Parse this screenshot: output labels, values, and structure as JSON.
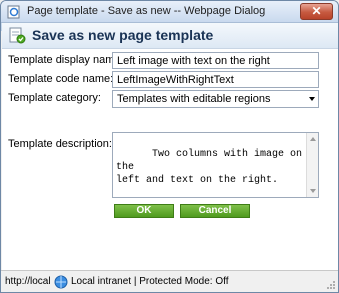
{
  "window": {
    "title": "Page template - Save as new -- Webpage Dialog",
    "close_label": "✕"
  },
  "header": {
    "title": "Save as new page template"
  },
  "form": {
    "display_name_label": "Template display name:",
    "display_name_value": "Left image with text on the right",
    "code_name_label": "Template code name:",
    "code_name_value": "LeftImageWithRightText",
    "category_label": "Template category:",
    "category_value": "Templates with editable regions",
    "description_label": "Template description:",
    "description_value": "Two columns with image on the\nleft and text on the right."
  },
  "buttons": {
    "ok_label": "OK",
    "cancel_label": "Cancel"
  },
  "statusbar": {
    "url": "http://localhost",
    "zone": "Local intranet | Protected Mode: Off"
  },
  "colors": {
    "button_green": "#5ea827",
    "header_title": "#1a3355",
    "close_red": "#c65a40"
  }
}
